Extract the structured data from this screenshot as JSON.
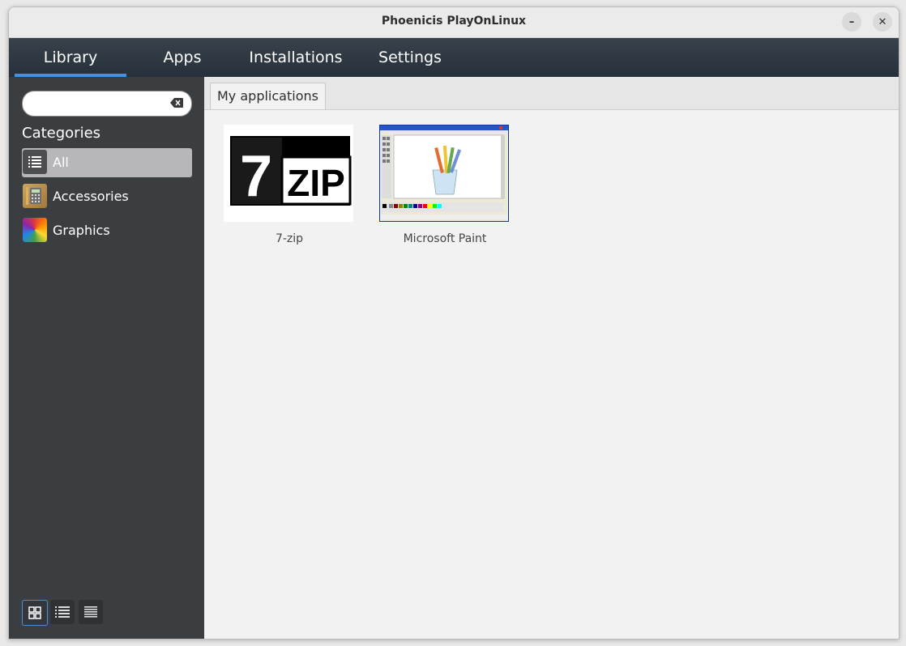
{
  "window": {
    "title": "Phoenicis PlayOnLinux",
    "minimize_icon": "minimize-icon",
    "close_icon": "close-icon"
  },
  "tabs": [
    {
      "label": "Library",
      "active": true
    },
    {
      "label": "Apps",
      "active": false
    },
    {
      "label": "Installations",
      "active": false
    },
    {
      "label": "Settings",
      "active": false
    }
  ],
  "sidebar": {
    "search": {
      "value": "",
      "placeholder": ""
    },
    "categories_heading": "Categories",
    "categories": [
      {
        "label": "All",
        "icon": "list-icon",
        "selected": true
      },
      {
        "label": "Accessories",
        "icon": "calculator-icon",
        "selected": false
      },
      {
        "label": "Graphics",
        "icon": "color-wheel-icon",
        "selected": false
      }
    ],
    "view_modes": [
      {
        "icon": "grid-view-icon",
        "selected": true
      },
      {
        "icon": "list-view-icon",
        "selected": false
      },
      {
        "icon": "detail-view-icon",
        "selected": false
      }
    ]
  },
  "content": {
    "tab_label": "My applications",
    "apps": [
      {
        "name": "7-zip",
        "icon": "7zip-logo"
      },
      {
        "name": "Microsoft Paint",
        "icon": "paint-screenshot"
      }
    ]
  },
  "colors": {
    "accent": "#4a90d9",
    "sidebar_bg": "#3b3e41",
    "tabsbar_bg": "#2f3943",
    "selected_item_bg": "#b7b7bb"
  }
}
